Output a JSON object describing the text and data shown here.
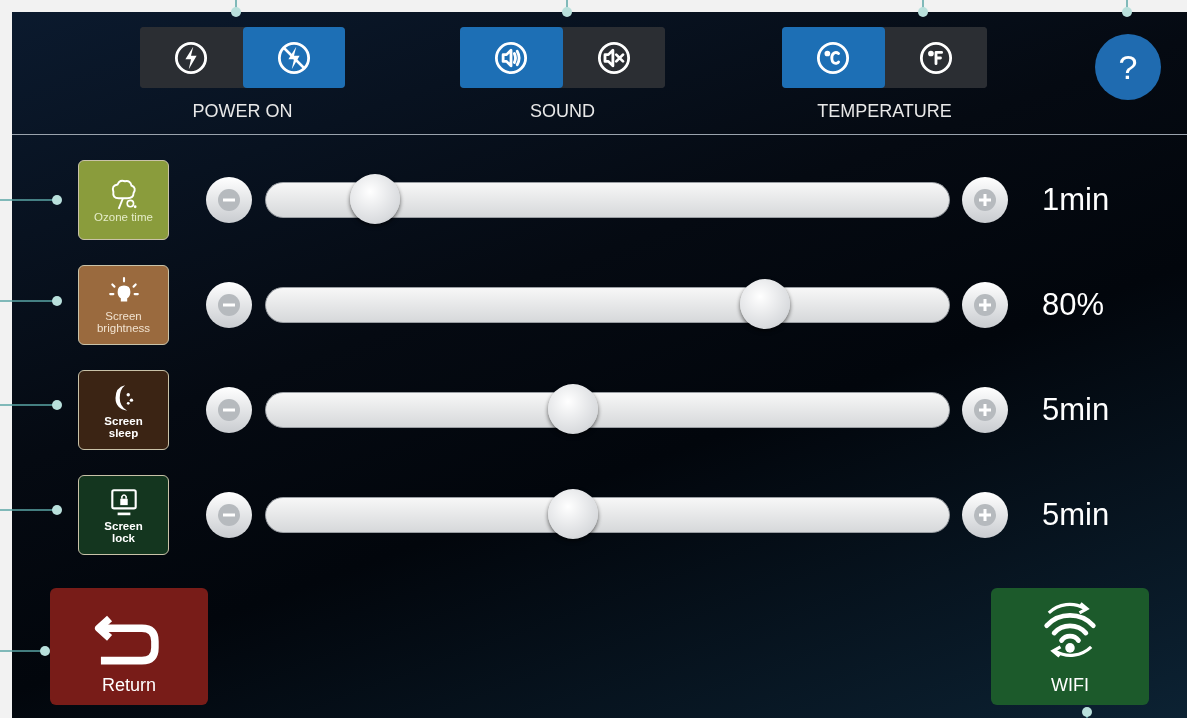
{
  "toggles": [
    {
      "label": "POWER ON",
      "options": [
        {
          "kind": "power",
          "selected": false
        },
        {
          "kind": "power-off",
          "selected": true
        }
      ]
    },
    {
      "label": "SOUND",
      "options": [
        {
          "kind": "sound",
          "selected": true
        },
        {
          "kind": "mute",
          "selected": false
        }
      ]
    },
    {
      "label": "TEMPERATURE",
      "options": [
        {
          "kind": "celsius",
          "selected": true
        },
        {
          "kind": "fahrenheit",
          "selected": false
        }
      ]
    }
  ],
  "help": {
    "label": "?"
  },
  "settings": [
    {
      "kind": "ozone",
      "label": "Ozone time",
      "level": 0.16,
      "value": "1min"
    },
    {
      "kind": "brightness",
      "label": "Screen brightness",
      "level": 0.73,
      "value": "80%"
    },
    {
      "kind": "sleep",
      "label": "Screen sleep",
      "level": 0.45,
      "value": "5min"
    },
    {
      "kind": "lock",
      "label": "Screen lock",
      "level": 0.45,
      "value": "5min"
    }
  ],
  "buttons": [
    {
      "kind": "return",
      "label": "Return"
    },
    {
      "kind": "wifi",
      "label": "WIFI"
    }
  ]
}
